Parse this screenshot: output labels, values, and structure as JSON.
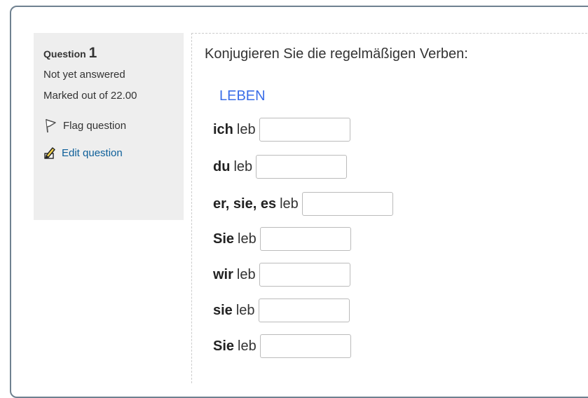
{
  "question": {
    "label": "Question",
    "number": "1",
    "state": "Not yet answered",
    "grade": "Marked out of 22.00",
    "flag_label": "Flag question",
    "edit_label": "Edit question"
  },
  "content": {
    "instruction": "Konjugieren Sie die regelmäßigen Verben:",
    "verb": "LEBEN",
    "rows": [
      {
        "pronoun": "ich",
        "stem": "leb",
        "value": ""
      },
      {
        "pronoun": "du",
        "stem": "leb",
        "value": ""
      },
      {
        "pronoun": "er, sie, es",
        "stem": "leb",
        "value": ""
      },
      {
        "pronoun": "Sie",
        "stem": "leb",
        "value": ""
      },
      {
        "pronoun": "wir",
        "stem": "leb",
        "value": ""
      },
      {
        "pronoun": "sie",
        "stem": "leb",
        "value": ""
      },
      {
        "pronoun": "Sie",
        "stem": "leb",
        "value": ""
      }
    ]
  },
  "icons": {
    "flag": "flag-icon",
    "edit": "edit-pencil-icon"
  },
  "colors": {
    "border": "#6f8190",
    "info_bg": "#eeeeee",
    "link": "#0d5f99",
    "verb": "#3b6ee8"
  }
}
